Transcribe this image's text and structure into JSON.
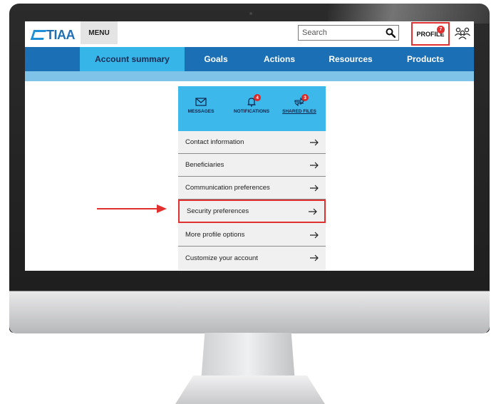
{
  "brand": {
    "logo_text": "TIAA"
  },
  "header": {
    "menu_label": "MENU",
    "search": {
      "placeholder": "Search"
    },
    "profile_label": "PROFILE",
    "profile_badge": "7"
  },
  "nav": {
    "items": [
      {
        "label": "Account summary",
        "active": true
      },
      {
        "label": "Goals",
        "active": false
      },
      {
        "label": "Actions",
        "active": false
      },
      {
        "label": "Resources",
        "active": false
      },
      {
        "label": "Products",
        "active": false
      }
    ]
  },
  "profile_menu": {
    "quick_links": [
      {
        "label": "MESSAGES",
        "icon": "envelope-icon",
        "badge": null
      },
      {
        "label": "NOTIFICATIONS",
        "icon": "bell-icon",
        "badge": "4"
      },
      {
        "label": "SHARED FILES",
        "icon": "shared-files-icon",
        "badge": "3"
      }
    ],
    "items": [
      {
        "label": "Contact information"
      },
      {
        "label": "Beneficiaries"
      },
      {
        "label": "Communication preferences"
      },
      {
        "label": "Security preferences",
        "highlighted": true
      },
      {
        "label": "More profile options"
      },
      {
        "label": "Customize your account"
      }
    ]
  },
  "colors": {
    "nav_background": "#1b6fb5",
    "nav_active": "#35b5e8",
    "highlight": "#e0302f",
    "badge": "#d92a2a"
  }
}
